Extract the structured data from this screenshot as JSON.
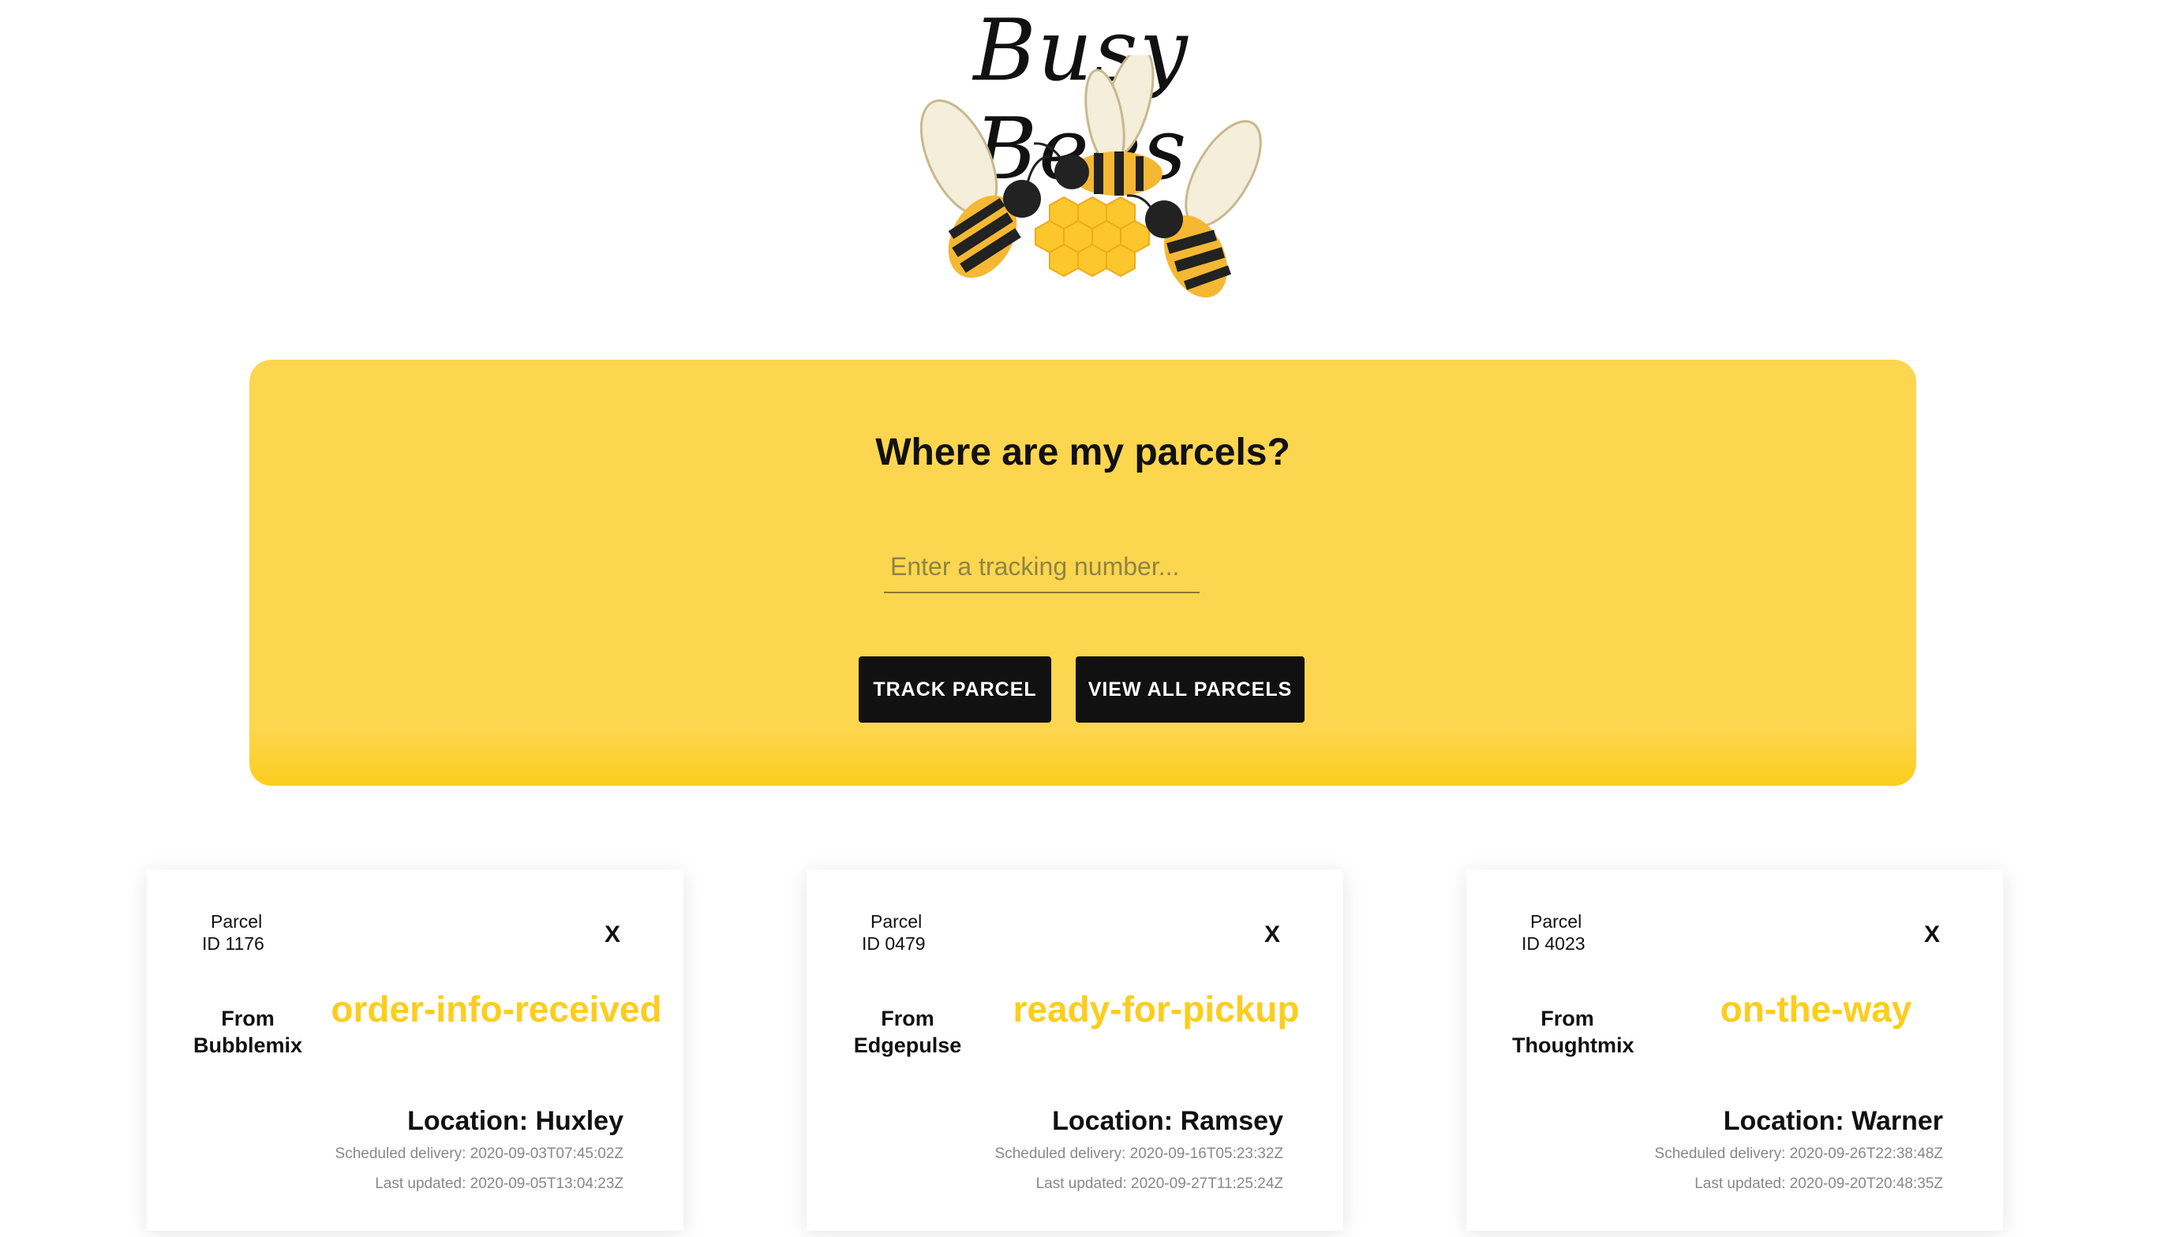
{
  "brand": {
    "title": "Busy Bees",
    "accent_color": "#fdd650",
    "status_color": "#fccd1c",
    "button_color": "#111111"
  },
  "search": {
    "heading": "Where are my parcels?",
    "placeholder": "Enter a tracking number...",
    "track_label": "TRACK PARCEL",
    "view_all_label": "VIEW ALL PARCELS"
  },
  "parcels": [
    {
      "label": "Parcel",
      "id": "ID 1176",
      "close": "X",
      "from_label": "From",
      "from": "Bubblemix",
      "status": "order-info-received",
      "location": "Location: Huxley",
      "scheduled": "Scheduled delivery: 2020-09-03T07:45:02Z",
      "updated": "Last updated: 2020-09-05T13:04:23Z"
    },
    {
      "label": "Parcel",
      "id": "ID 0479",
      "close": "X",
      "from_label": "From",
      "from": "Edgepulse",
      "status": "ready-for-pickup",
      "location": "Location: Ramsey",
      "scheduled": "Scheduled delivery: 2020-09-16T05:23:32Z",
      "updated": "Last updated: 2020-09-27T11:25:24Z"
    },
    {
      "label": "Parcel",
      "id": "ID 4023",
      "close": "X",
      "from_label": "From",
      "from": "Thoughtmix",
      "status": "on-the-way",
      "location": "Location: Warner",
      "scheduled": "Scheduled delivery: 2020-09-26T22:38:48Z",
      "updated": "Last updated: 2020-09-20T20:48:35Z"
    }
  ]
}
